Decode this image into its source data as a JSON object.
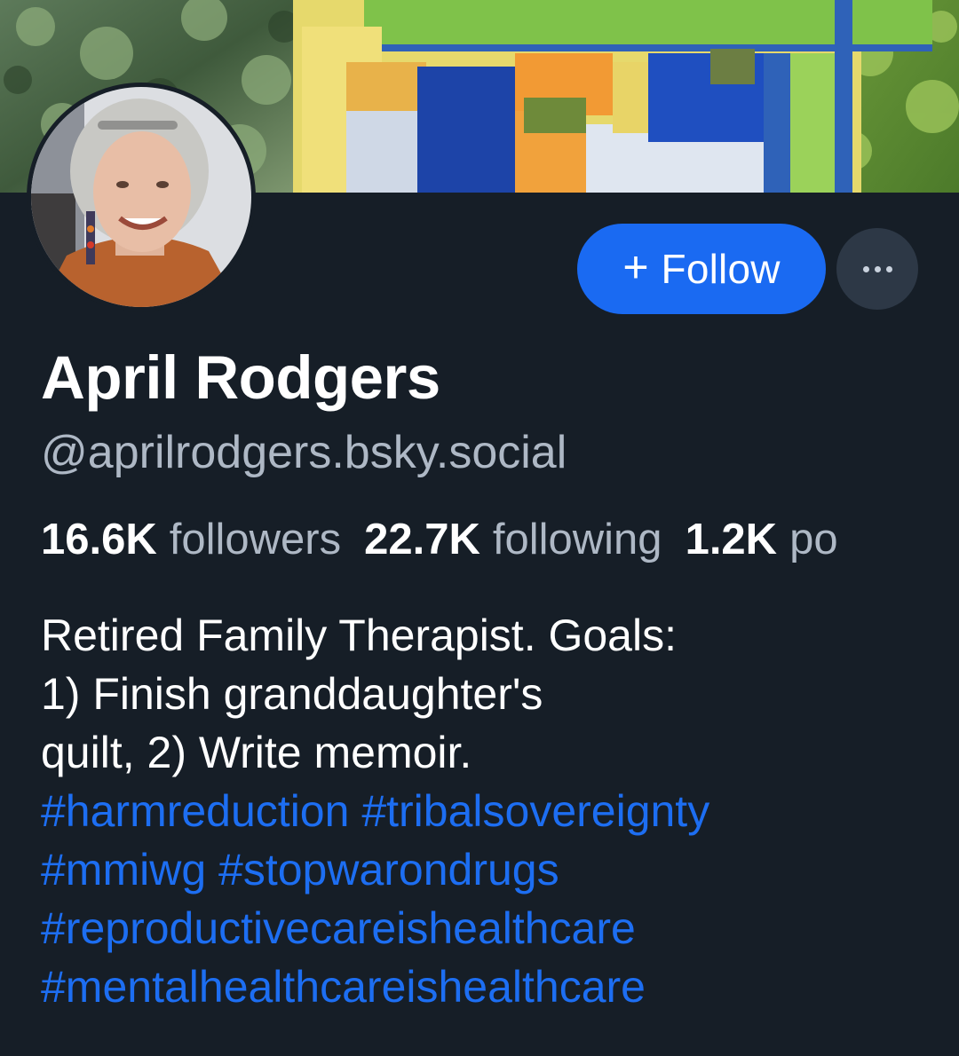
{
  "profile": {
    "display_name": "April Rodgers",
    "handle": "@aprilrodgers.bsky.social"
  },
  "actions": {
    "follow_plus": "+",
    "follow_label": "Follow"
  },
  "stats": [
    {
      "value": "16.6K",
      "label": "followers"
    },
    {
      "value": "22.7K",
      "label": "following"
    },
    {
      "value": "1.2K",
      "label": "po"
    }
  ],
  "bio": {
    "lines": [
      "Retired Family Therapist. Goals:",
      "1) Finish granddaughter's",
      "quilt, 2) Write memoir."
    ],
    "hashtags": [
      "#harmreduction",
      "#tribalsovereignty",
      "#mmiwg",
      "#stopwarondrugs",
      "#reproductivecareishealthcare",
      "#mentalhealthcareishealthcare"
    ]
  },
  "colors": {
    "background": "#161e27",
    "accent": "#1a6af2",
    "hashtag": "#1d6ef2",
    "muted_text": "#aeb8c5",
    "more_button": "#2d3846"
  },
  "icons": {
    "more": "more-horizontal-icon",
    "plus": "plus-icon"
  }
}
